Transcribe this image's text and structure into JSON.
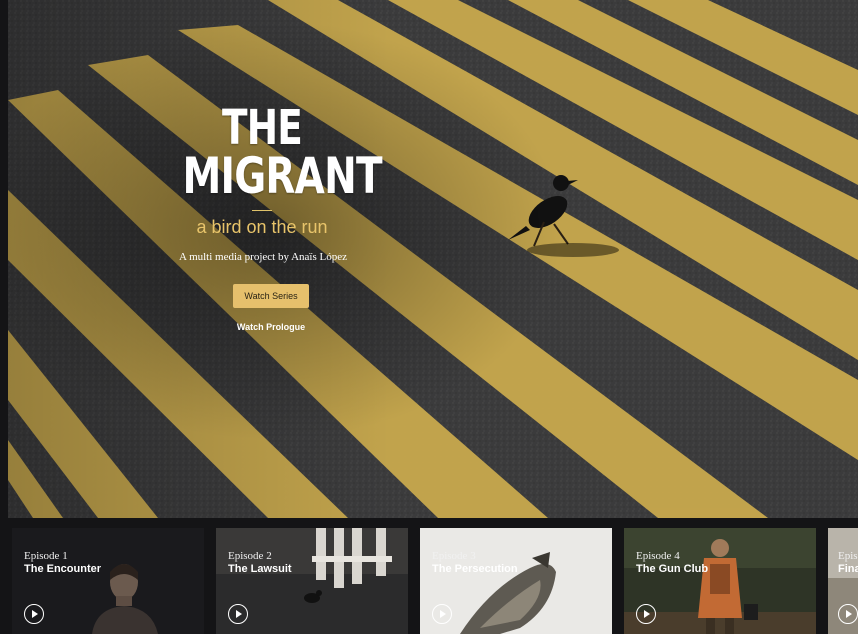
{
  "hero": {
    "title_line1": "THE",
    "title_line2": "MIGRANT",
    "subtitle": "a bird on the run",
    "byline": "A multi media project by Anaïs López",
    "watch_series_label": "Watch Series",
    "watch_prologue_label": "Watch Prologue",
    "colors": {
      "accent": "#e6c06c",
      "road": "#3a3a3a",
      "stripe": "#c9a94d"
    }
  },
  "episodes": [
    {
      "number": "Episode 1",
      "title": "The Encounter"
    },
    {
      "number": "Episode 2",
      "title": "The Lawsuit"
    },
    {
      "number": "Episode 3",
      "title": "The Persecution"
    },
    {
      "number": "Episode 4",
      "title": "The Gun Club"
    },
    {
      "number": "Epis",
      "title": "Fina"
    }
  ],
  "icons": {
    "play": "play-circle-icon"
  }
}
